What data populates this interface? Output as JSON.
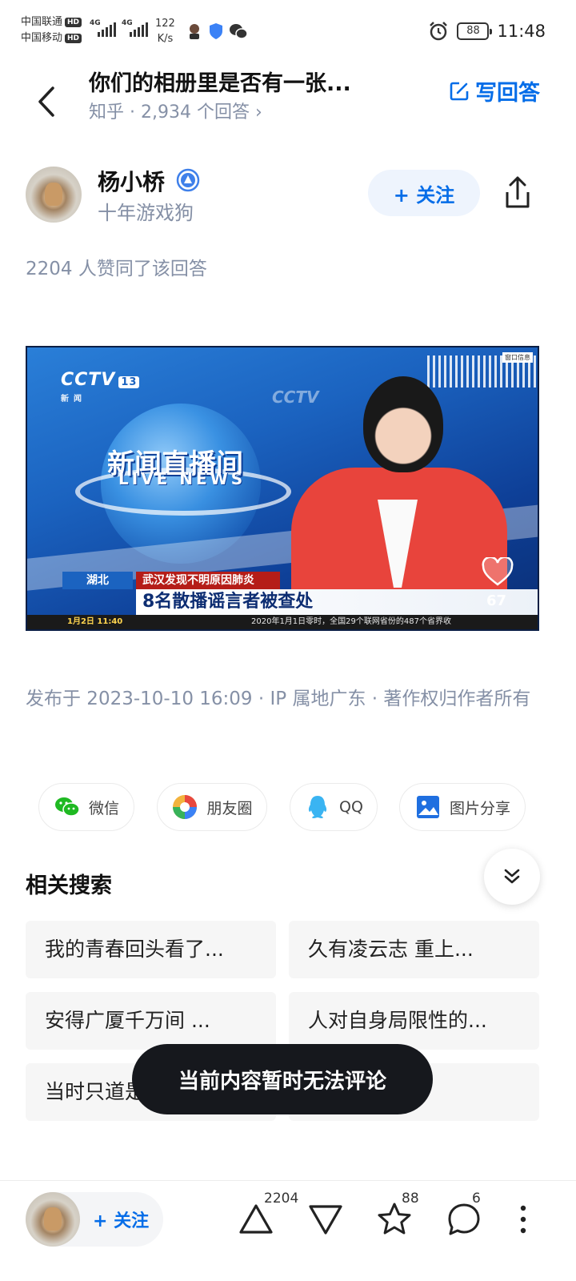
{
  "status_bar": {
    "carrier_1": "中国联通",
    "carrier_2": "中国移动",
    "hd": "HD",
    "network": "4G",
    "speed_value": "122",
    "speed_unit": "K/s",
    "battery": "88",
    "time": "11:48"
  },
  "header": {
    "question_title": "你们的相册里是否有一张...",
    "source": "知乎",
    "separator": "·",
    "answer_count": "2,934 个回答",
    "more_arrow": "›",
    "write_answer_label": "写回答"
  },
  "author": {
    "name": "杨小桥",
    "bio": "十年游戏狗",
    "follow_label": "+ 关注"
  },
  "votes_line": "2204 人赞同了该回答",
  "news_image": {
    "channel": "CCTV",
    "channel_number": "13",
    "channel_sub": "新闻",
    "program_cn": "新闻直播间",
    "program_en": "LIVE NEWS",
    "corner_tag": "窗口信息",
    "location": "湖北",
    "top_line": "武汉发现不明原因肺炎",
    "headline": "8名散播谣言者被查处",
    "date": "1月2日",
    "time": "11:40",
    "ticker": "2020年1月1日零时，全国29个联网省份的487个省界收",
    "likes": "67"
  },
  "meta": "发布于 2023-10-10 16:09 · IP 属地广东 · 著作权归作者所有",
  "share": [
    {
      "label": "微信",
      "icon": "wechat-icon"
    },
    {
      "label": "朋友圈",
      "icon": "moments-icon"
    },
    {
      "label": "QQ",
      "icon": "qq-icon"
    },
    {
      "label": "图片分享",
      "icon": "image-share-icon"
    }
  ],
  "related": {
    "title": "相关搜索",
    "items": [
      "我的青春回头看了...",
      "久有凌云志 重上...",
      "安得广厦千万间 ...",
      "人对自身局限性的...",
      "当时只道是寻常",
      ""
    ]
  },
  "toast": "当前内容暂时无法评论",
  "bottom_bar": {
    "follow_label": "+ 关注",
    "upvote_count": "2204",
    "favorite_count": "88",
    "comment_count": "6"
  },
  "colors": {
    "brand_blue": "#056de8",
    "muted_text": "#8590a6",
    "toast_bg": "#16181d"
  }
}
